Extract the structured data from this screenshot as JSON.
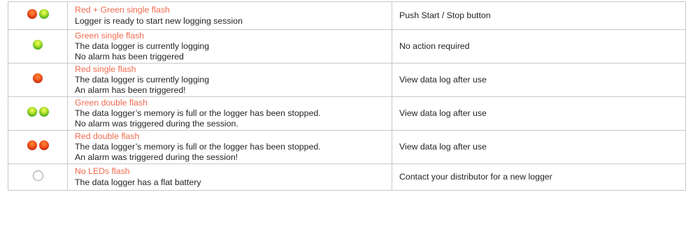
{
  "rows": [
    {
      "leds": [
        "red",
        "green"
      ],
      "mode": "Red + Green single flash",
      "lines": [
        "Logger is ready to start new logging session"
      ],
      "action": "Push Start / Stop button"
    },
    {
      "leds": [
        "green"
      ],
      "mode": "Green single flash",
      "lines": [
        "The data logger is currently logging",
        "No alarm has been triggered"
      ],
      "action": "No action required"
    },
    {
      "leds": [
        "red"
      ],
      "mode": "Red single flash",
      "lines": [
        "The data logger is currently logging",
        "An alarm has been triggered!"
      ],
      "action": "View data log after use"
    },
    {
      "leds": [
        "green",
        "green"
      ],
      "mode": "Green double flash",
      "lines": [
        "The data logger’s memory is full or the logger has been stopped.",
        "No alarm was triggered during the session."
      ],
      "action": "View data log after use"
    },
    {
      "leds": [
        "red",
        "red"
      ],
      "mode": "Red double flash",
      "lines": [
        "The data logger’s memory is full or the logger has been stopped.",
        "An alarm was triggered during the session!"
      ],
      "action": "View data log after use"
    },
    {
      "leds": [
        "off"
      ],
      "mode": "No LEDs flash",
      "lines": [
        "The data logger has a flat battery"
      ],
      "action": "Contact your distributor for a new logger"
    }
  ],
  "colors": {
    "mode_text": "#ef6a4e",
    "body_text": "#231f20",
    "border": "#c8c8c8",
    "led_red": "#f25a1d",
    "led_green": "#58b422"
  }
}
